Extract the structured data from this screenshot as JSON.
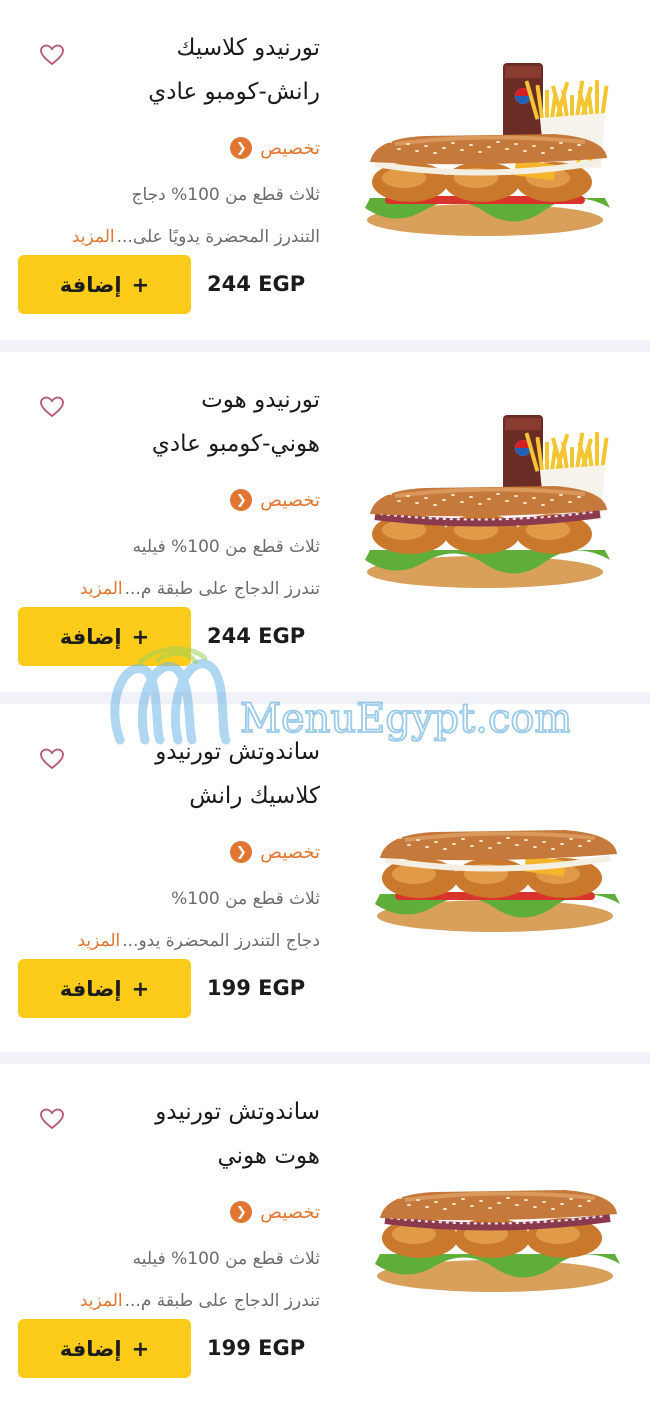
{
  "items": [
    {
      "title_line1": "تورنيدو كلاسيك",
      "title_line2": "رانش-كومبو عادي",
      "customize_label": "تخصيص",
      "desc_line1": "ثلاث قطع من 100% دجاج",
      "desc_line2": "التندرز المحضرة يدويًا على...",
      "more_label": "المزيد",
      "price": "244 EGP",
      "add_label": "إضافة",
      "add_icon": "+",
      "image_icon": "classic-ranch-combo-sandwich-image",
      "combo": true,
      "sauce": "ranch"
    },
    {
      "title_line1": "تورنيدو هوت",
      "title_line2": "هوني-كومبو عادي",
      "customize_label": "تخصيص",
      "desc_line1": "ثلاث قطع من 100% فيليه",
      "desc_line2": "تندرز الدجاج على طبقة م...",
      "more_label": "المزيد",
      "price": "244 EGP",
      "add_label": "إضافة",
      "add_icon": "+",
      "image_icon": "hot-honey-combo-sandwich-image",
      "combo": true,
      "sauce": "hot-honey"
    },
    {
      "title_line1": "ساندوتش تورنيدو",
      "title_line2": "كلاسيك رانش",
      "customize_label": "تخصيص",
      "desc_line1": "ثلاث قطع  من 100%",
      "desc_line2": "دجاج التندرز المحضرة يدو...",
      "more_label": "المزيد",
      "price": "199 EGP",
      "add_label": "إضافة",
      "add_icon": "+",
      "image_icon": "classic-ranch-sandwich-image",
      "combo": false,
      "sauce": "ranch"
    },
    {
      "title_line1": "ساندوتش تورنيدو",
      "title_line2": "هوت هوني",
      "customize_label": "تخصيص",
      "desc_line1": "ثلاث قطع من 100% فيليه",
      "desc_line2": "تندرز الدجاج على طبقة م...",
      "more_label": "المزيد",
      "price": "199 EGP",
      "add_label": "إضافة",
      "add_icon": "+",
      "image_icon": "hot-honey-sandwich-image",
      "combo": false,
      "sauce": "hot-honey"
    }
  ],
  "watermark": "MenuEgypt.com",
  "colors": {
    "accent_orange": "#e0762f",
    "button_yellow": "#fdcc1a",
    "separator": "#f1f2f7",
    "heart": "#b5566f",
    "watermark_blue": "#3f9bd6"
  }
}
